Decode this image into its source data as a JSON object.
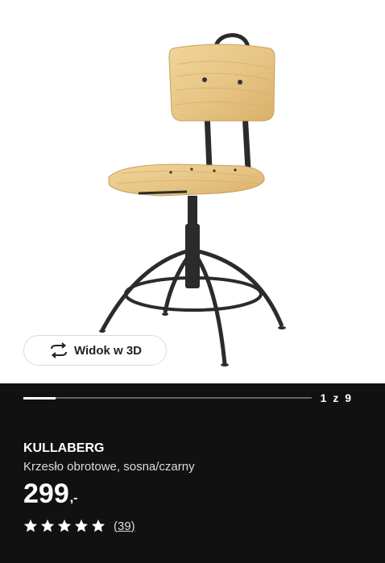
{
  "product": {
    "name": "KULLABERG",
    "description": "Krzesło obrotowe, sosna/czarny",
    "price_integer": "299",
    "price_decimal": ",-",
    "rating": 5,
    "reviews_label": "(39)"
  },
  "gallery": {
    "view3d_label": "Widok w 3D",
    "pager": "1 z 9",
    "progress": 0.111
  },
  "colors": {
    "panel_bg": "#111111",
    "wood": "#e8c98a",
    "metal": "#2b2b2b"
  },
  "icons": {
    "view3d": "rotate-3d-icon",
    "star": "star-icon"
  }
}
